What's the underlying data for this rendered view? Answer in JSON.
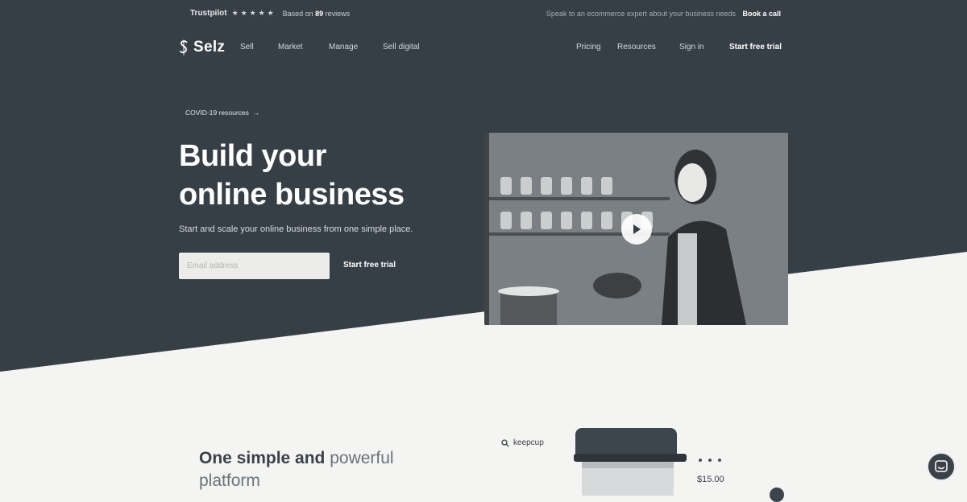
{
  "topbar": {
    "trustpilot": "Trustpilot",
    "stars": 5,
    "reviews_prefix": "Based on",
    "reviews_count": "89",
    "reviews_suffix": "reviews",
    "speak_text": "Speak to an ecommerce expert about your business needs",
    "book_call": "Book a call"
  },
  "nav": {
    "logo": "Selz",
    "left_items": [
      "Sell",
      "Market",
      "Manage",
      "Sell digital"
    ],
    "right_items": [
      "Pricing",
      "Resources",
      "Sign in"
    ],
    "cta": "Start free trial"
  },
  "hero": {
    "covid_link": "COVID-19 resources",
    "covid_arrow": "→",
    "headline_line1": "Build your",
    "headline_line2": "online business",
    "subtitle": "Start and scale your online business from one simple place.",
    "email_placeholder": "Email address",
    "trial_button": "Start free trial"
  },
  "platform": {
    "title_bold": "One simple and",
    "title_light": "powerful",
    "title_line2": "platform",
    "search_text": "keepcup",
    "price": "$15.00"
  },
  "colors": {
    "hero_bg": "#363e46",
    "page_bg": "#f4f4f3",
    "text_dark": "#3a4148"
  },
  "icons": {
    "play": "play-icon",
    "search": "search-icon",
    "chat": "chat-icon",
    "arrow": "arrow-right-icon"
  }
}
